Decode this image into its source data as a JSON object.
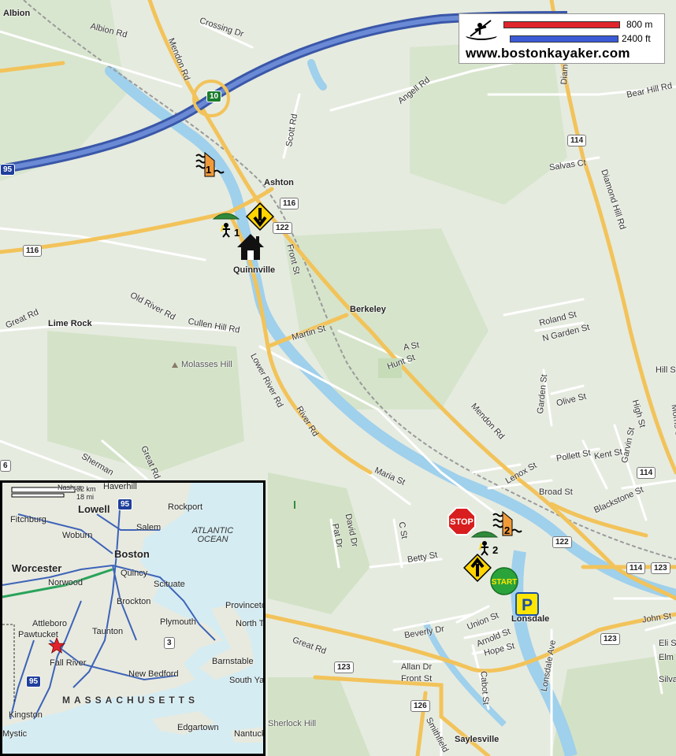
{
  "map": {
    "colors": {
      "land": "#e6ebe0",
      "forest": "#cfe0c4",
      "water": "#9fd0ec",
      "highway": "#4a69b8",
      "major_road": "#f2c35a",
      "route_road": "#f5d27a",
      "minor_road": "#ffffff",
      "rail": "#9a9a9a"
    },
    "towns": [
      {
        "name": "Albion"
      },
      {
        "name": "Ashton"
      },
      {
        "name": "Quinnville"
      },
      {
        "name": "Berkeley"
      },
      {
        "name": "Lime Rock"
      },
      {
        "name": "Lonsdale"
      },
      {
        "name": "Saylesville"
      }
    ],
    "roads": [
      {
        "name": "Albion Rd"
      },
      {
        "name": "Crossing Dr"
      },
      {
        "name": "Mendon Rd"
      },
      {
        "name": "Angell Rd"
      },
      {
        "name": "Scott Rd"
      },
      {
        "name": "Bear Hill Rd"
      },
      {
        "name": "Diamond Hill Rd"
      },
      {
        "name": "Salvas Ct"
      },
      {
        "name": "Front St"
      },
      {
        "name": "Old River Rd"
      },
      {
        "name": "Cullen Hill Rd"
      },
      {
        "name": "Martin St"
      },
      {
        "name": "Great Rd"
      },
      {
        "name": "Lower River Rd"
      },
      {
        "name": "River Rd"
      },
      {
        "name": "A St"
      },
      {
        "name": "Hunt St"
      },
      {
        "name": "Roland St"
      },
      {
        "name": "N Garden St"
      },
      {
        "name": "Garden St"
      },
      {
        "name": "Olive St"
      },
      {
        "name": "Mendon Rd"
      },
      {
        "name": "Lenox St"
      },
      {
        "name": "Pollett St"
      },
      {
        "name": "Kent St"
      },
      {
        "name": "Garvin St"
      },
      {
        "name": "High St"
      },
      {
        "name": "Morris St"
      },
      {
        "name": "Broad St"
      },
      {
        "name": "Blackstone St"
      },
      {
        "name": "Maria St"
      },
      {
        "name": "David Dr"
      },
      {
        "name": "Pat Dr"
      },
      {
        "name": "C St"
      },
      {
        "name": "Betty St"
      },
      {
        "name": "Beverly Dr"
      },
      {
        "name": "Union St"
      },
      {
        "name": "Arnold St"
      },
      {
        "name": "Hope St"
      },
      {
        "name": "Allan Dr"
      },
      {
        "name": "Front St"
      },
      {
        "name": "Cabot St"
      },
      {
        "name": "Lonsdale Ave"
      },
      {
        "name": "John St"
      },
      {
        "name": "Eli St"
      },
      {
        "name": "Elm St"
      },
      {
        "name": "Silva St"
      },
      {
        "name": "Sherman"
      },
      {
        "name": "Great Rd"
      },
      {
        "name": "Great Rd"
      },
      {
        "name": "Smithfield"
      },
      {
        "name": "Hill St"
      },
      {
        "name": "Diamond"
      }
    ],
    "hills": [
      "Molasses Hill",
      "Sherlock Hill"
    ],
    "route_shields": [
      "10",
      "116",
      "116",
      "122",
      "114",
      "123",
      "114",
      "122",
      "123",
      "123",
      "126",
      "114",
      "95",
      "6"
    ],
    "markers": [
      {
        "type": "rapids",
        "number": "1"
      },
      {
        "type": "portage",
        "number": "1"
      },
      {
        "type": "take-out",
        "symbol": "down-arrow"
      },
      {
        "type": "house"
      },
      {
        "type": "stop",
        "label": "STOP"
      },
      {
        "type": "rapids",
        "number": "2"
      },
      {
        "type": "portage",
        "number": "2"
      },
      {
        "type": "put-in",
        "symbol": "up-arrow"
      },
      {
        "type": "start",
        "label": "START"
      },
      {
        "type": "parking",
        "label": "P"
      }
    ]
  },
  "scale": {
    "metric_label": "800 m",
    "imperial_label": "2400 ft",
    "metric_color": "#e0242c",
    "imperial_color": "#3b5bd6",
    "website": "www.bostonkayaker.com"
  },
  "inset": {
    "scale": {
      "km": "32 km",
      "mi": "18 mi"
    },
    "cities": [
      {
        "name": "Nashua"
      },
      {
        "name": "Haverhill"
      },
      {
        "name": "Lowell"
      },
      {
        "name": "Rockport"
      },
      {
        "name": "Fitchburg"
      },
      {
        "name": "Salem"
      },
      {
        "name": "Woburn"
      },
      {
        "name": "Boston"
      },
      {
        "name": "Worcester"
      },
      {
        "name": "Quincy"
      },
      {
        "name": "Norwood"
      },
      {
        "name": "Scituate"
      },
      {
        "name": "Brockton"
      },
      {
        "name": "Provincetown"
      },
      {
        "name": "North Truro"
      },
      {
        "name": "Attleboro"
      },
      {
        "name": "Plymouth"
      },
      {
        "name": "Pawtucket"
      },
      {
        "name": "Taunton"
      },
      {
        "name": "Barnstable"
      },
      {
        "name": "Fall River"
      },
      {
        "name": "New Bedford"
      },
      {
        "name": "South Yarmouth"
      },
      {
        "name": "Kingston"
      },
      {
        "name": "Edgartown"
      },
      {
        "name": "Nantucket"
      },
      {
        "name": "Mystic"
      }
    ],
    "ocean": "ATLANTIC OCEAN",
    "state": "MASSACHUSETTS",
    "shields": [
      "95",
      "95",
      "3"
    ],
    "star_color": "#e0242c"
  }
}
